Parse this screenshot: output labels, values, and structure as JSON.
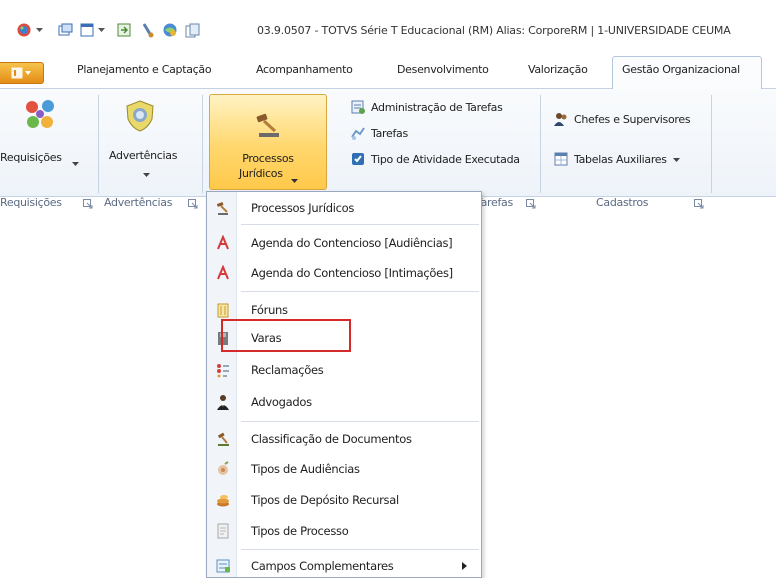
{
  "window": {
    "title": "03.9.0507 - TOTVS Série T Educacional (RM) Alias: CorporeRM | 1-UNIVERSIDADE CEUMA"
  },
  "tabs": [
    {
      "label": "Planejamento e Captação"
    },
    {
      "label": "Acompanhamento"
    },
    {
      "label": "Desenvolvimento"
    },
    {
      "label": "Valorização"
    },
    {
      "label": "Gestão Organizacional"
    }
  ],
  "ribbon": {
    "requisicoes": {
      "button_label": "Requisições",
      "group_label": "Requisições"
    },
    "advertencias": {
      "button_label": "Advertências",
      "group_label": "Advertências"
    },
    "processos": {
      "button_line1": "Processos",
      "button_line2": "Jurídicos"
    },
    "tarefas": {
      "items": [
        "Administração de Tarefas",
        "Tarefas",
        "Tipo de Atividade Executada"
      ],
      "group_label": "Tarefas"
    },
    "cadastros": {
      "items": [
        "Chefes e Supervisores",
        "Tabelas Auxiliares"
      ],
      "group_label": "Cadastros"
    }
  },
  "menu": {
    "items": [
      {
        "label": "Processos Jurídicos",
        "icon": "gavel-icon"
      },
      {
        "label": "Agenda do Contencioso [Audiências]",
        "icon": "calendar-icon"
      },
      {
        "label": "Agenda do Contencioso [Intimações]",
        "icon": "calendar-icon"
      },
      {
        "label": "Fóruns",
        "icon": "building-icon"
      },
      {
        "label": "Varas",
        "icon": "book-icon"
      },
      {
        "label": "Reclamações",
        "icon": "list-icon"
      },
      {
        "label": "Advogados",
        "icon": "person-icon"
      },
      {
        "label": "Classificação de Documentos",
        "icon": "gavel-icon"
      },
      {
        "label": "Tipos de Audiências",
        "icon": "hearing-icon"
      },
      {
        "label": "Tipos de Depósito Recursal",
        "icon": "coins-icon"
      },
      {
        "label": "Tipos de Processo",
        "icon": "document-icon"
      },
      {
        "label": "Campos Complementares",
        "icon": "fields-icon"
      }
    ],
    "highlighted": "Varas"
  },
  "colors": {
    "active_button": "#ffd76e",
    "highlight_box": "#d42a2a",
    "ribbon_bg": "#eef3f9"
  }
}
